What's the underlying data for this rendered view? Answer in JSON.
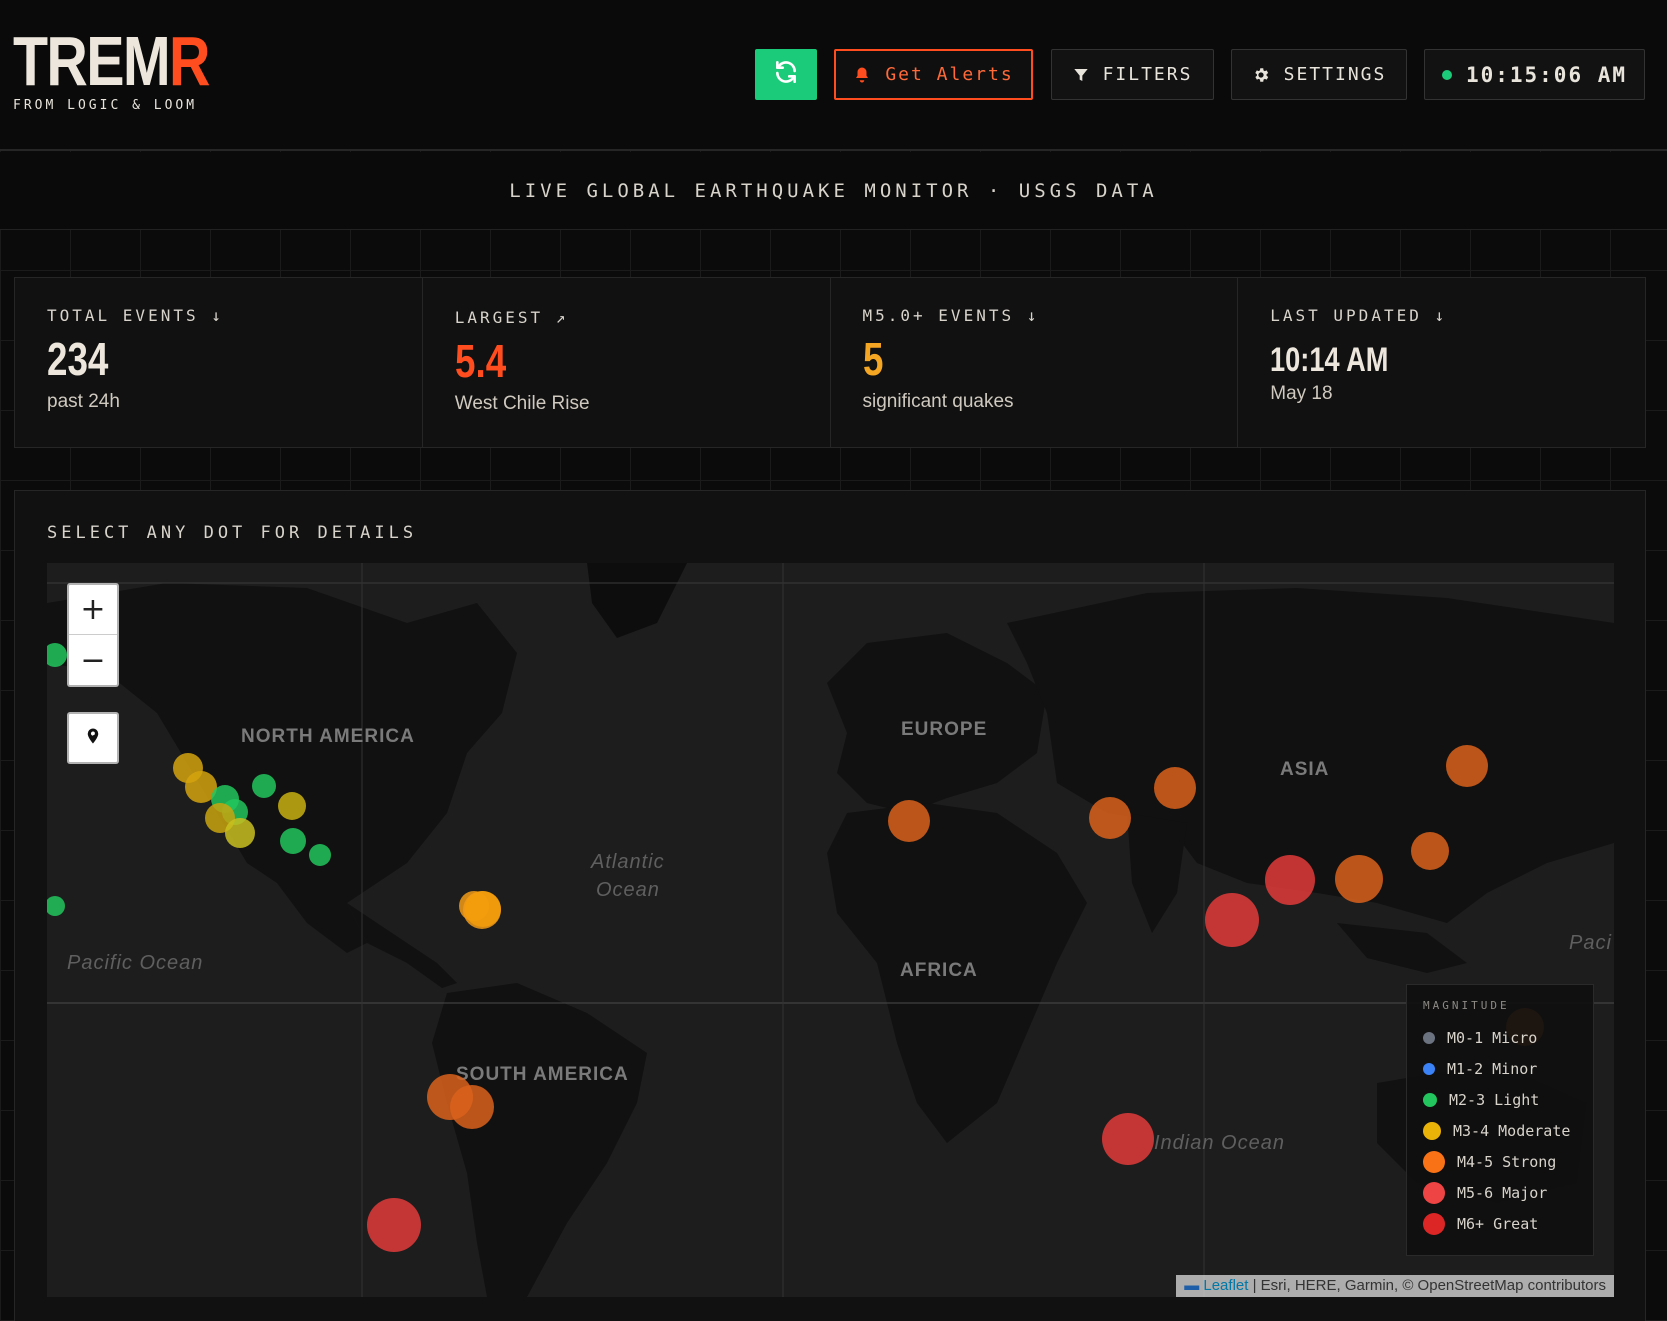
{
  "header": {
    "logo_main": "TREM",
    "logo_accent": "R",
    "tagline": "FROM LOGIC & LOOM",
    "alerts_label": "Get Alerts",
    "filters_label": "FILTERS",
    "settings_label": "SETTINGS",
    "clock": "10:15:06 AM"
  },
  "subtitle": "LIVE GLOBAL EARTHQUAKE MONITOR · USGS DATA",
  "stats": [
    {
      "label": "TOTAL EVENTS ↓",
      "value": "234",
      "sub": "past 24h",
      "color": "#ece6dc"
    },
    {
      "label": "LARGEST ↗",
      "value": "5.4",
      "sub": "West Chile Rise",
      "color": "#ff4d1f"
    },
    {
      "label": "M5.0+ EVENTS ↓",
      "value": "5",
      "sub": "significant quakes",
      "color": "#f5a623"
    },
    {
      "label": "LAST UPDATED ↓",
      "value": "10:14 AM",
      "sub": "May 18",
      "color": "#ece6dc"
    }
  ],
  "map": {
    "title": "SELECT ANY DOT FOR DETAILS",
    "zoom_in": "+",
    "zoom_out": "−",
    "labels": {
      "north_america": "NORTH AMERICA",
      "europe": "EUROPE",
      "asia": "ASIA",
      "africa": "AFRICA",
      "south_america": "SOUTH AMERICA",
      "atlantic": "Atlantic",
      "atlantic2": "Ocean",
      "pacific": "Pacific Ocean",
      "pacific_right": "Paci",
      "indian": "Indian Ocean"
    },
    "legend": {
      "title": "MAGNITUDE",
      "items": [
        {
          "label": "M0-1 Micro",
          "color": "#6b7280"
        },
        {
          "label": "M1-2 Minor",
          "color": "#3b82f6"
        },
        {
          "label": "M2-3 Light",
          "color": "#22c55e"
        },
        {
          "label": "M3-4 Moderate",
          "color": "#eab308"
        },
        {
          "label": "M4-5 Strong",
          "color": "#f97316"
        },
        {
          "label": "M5-6 Major",
          "color": "#ef4444"
        },
        {
          "label": "M6+ Great",
          "color": "#dc2626"
        }
      ]
    },
    "attribution_leaflet": "Leaflet",
    "attribution_rest": " | Esri, HERE, Garmin, © OpenStreetMap contributors"
  }
}
